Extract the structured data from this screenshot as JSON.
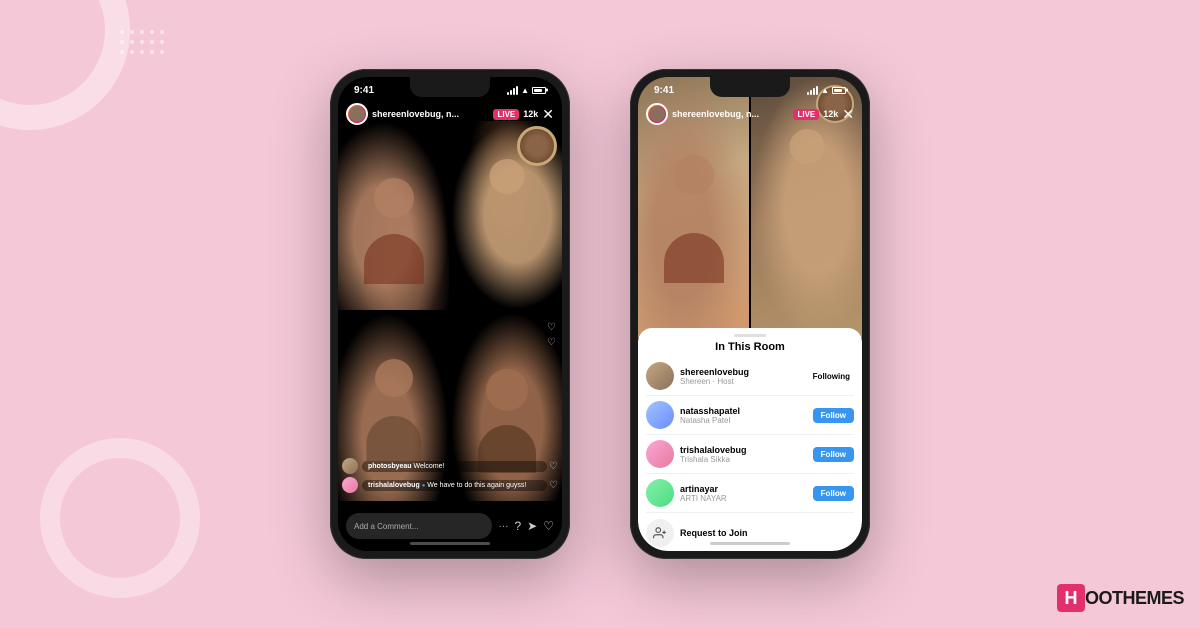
{
  "background": {
    "color": "#f5c8d8"
  },
  "logo": {
    "h": "H",
    "text": "OOTHEMES"
  },
  "phone1": {
    "status_time": "9:41",
    "live_username": "shereenlovebug, n...",
    "live_badge": "LIVE",
    "live_count": "12k",
    "comment_placeholder": "Add a Comment...",
    "comments": [
      {
        "username": "photosbyeau",
        "text": "Welcome!"
      },
      {
        "username": "trishalalovebug ✓",
        "text": "We have to do this again guyss!"
      }
    ]
  },
  "phone2": {
    "status_time": "9:41",
    "live_username": "shereenlovebug, n...",
    "live_badge": "LIVE",
    "live_count": "12k",
    "sheet": {
      "title": "In This Room",
      "handle": true,
      "users": [
        {
          "username": "shereenlovebug",
          "display": "Shereen · Host",
          "action": "Following",
          "action_type": "following"
        },
        {
          "username": "natasshapatel",
          "display": "Natasha Patel",
          "action": "Follow",
          "action_type": "follow"
        },
        {
          "username": "trishalalovebug",
          "display": "Trishala Sikka",
          "action": "Follow",
          "action_type": "follow"
        },
        {
          "username": "artinayar",
          "display": "ARTI NAYAR",
          "action": "Follow",
          "action_type": "follow"
        }
      ],
      "request_label": "Request to Join"
    }
  }
}
